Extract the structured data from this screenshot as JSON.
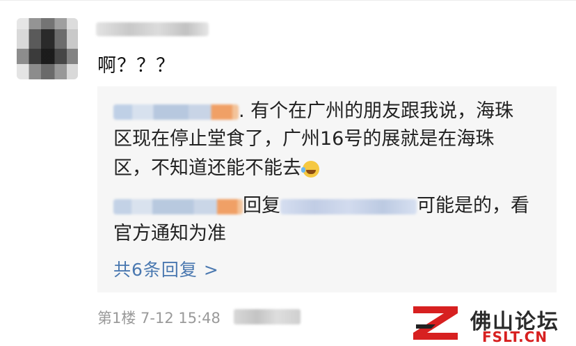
{
  "comment": {
    "text": "啊？？？"
  },
  "reply_thread": {
    "first_reply": {
      "line1": ". 有个在广州的朋友跟我说，海珠",
      "line2": "区现在停止堂食了，广州16号的展就是在海珠",
      "line3": "区，不知道还能不能去"
    },
    "second_reply": {
      "reply_word": "回复",
      "line1_tail": "可能是的，看",
      "line2": "官方通知为准"
    },
    "more_replies": "共6条回复 >"
  },
  "footer": {
    "floor_time": "第1楼 7-12 15:48"
  },
  "watermark": {
    "title": "佛山论坛",
    "domain": "FSLT.CN",
    "icon": "z-logo-icon"
  },
  "colors": {
    "link": "#4a78b0",
    "reply_background": "#f6f6f6",
    "meta": "#9a9a9a",
    "watermark_red": "#d72020"
  }
}
